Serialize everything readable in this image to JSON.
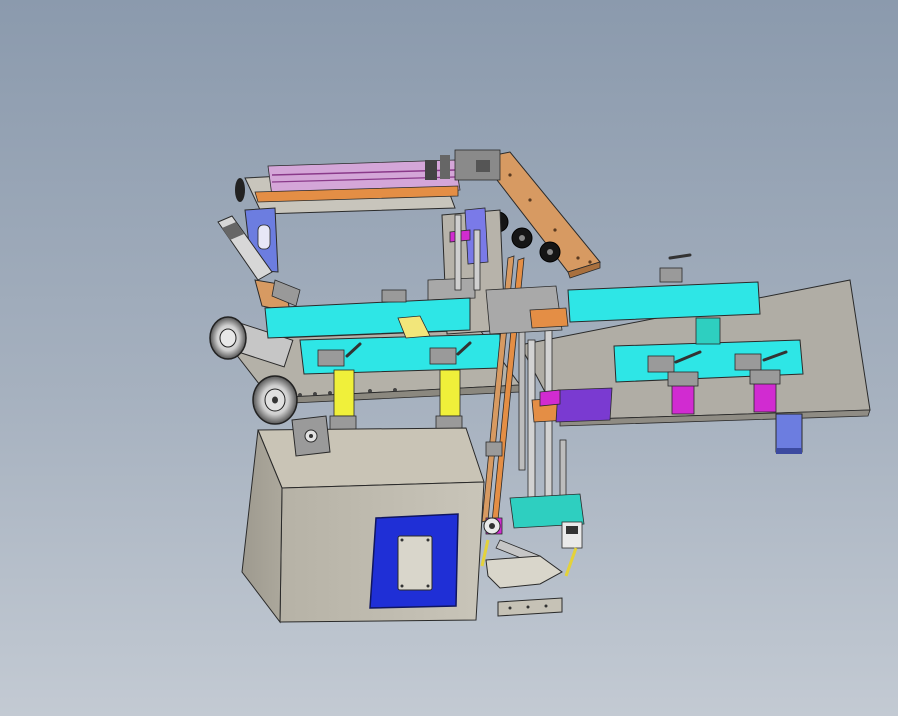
{
  "viewport": {
    "background_top": "#8b9aad",
    "background_bottom": "#c3cad3"
  },
  "model": {
    "colors": {
      "frame": "#b9b6ae",
      "cyan_guide": "#2ee6e6",
      "orange_plate": "#d79a62",
      "blue_panel": "#1f2fd6",
      "magenta_part": "#d12bd1",
      "motor_blue": "#6c7de0",
      "yellow_slide": "#f0f03a",
      "outline": "#2a2a2a"
    },
    "parts": [
      "cabinet",
      "control-panel",
      "main-table",
      "cyan-guide-rail",
      "orange-top-plate",
      "roller",
      "vertical-rod",
      "clamp",
      "motor",
      "handle"
    ]
  }
}
